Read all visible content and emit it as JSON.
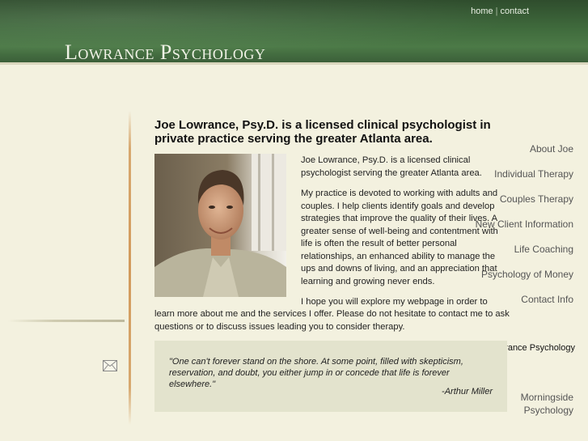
{
  "header": {
    "nav": {
      "home": "home",
      "separator": "|",
      "contact": "contact"
    },
    "logo_text": "Lowrance Psychology",
    "colors": {
      "header_green": "#3f6a3c",
      "background": "#f3f1df",
      "accent_rule": "#d29a5b"
    }
  },
  "sidebar": {
    "items": [
      {
        "label": "About Joe"
      },
      {
        "label": "Individual Therapy"
      },
      {
        "label": "Couples Therapy"
      },
      {
        "label": "New Client Information"
      },
      {
        "label": "Life Coaching"
      },
      {
        "label": "Psychology of Money"
      },
      {
        "label": "Contact Info"
      }
    ],
    "practice_label": "Lowrance Psychology",
    "mail_icon": "envelope-icon",
    "affiliate_line1": "Morningside",
    "affiliate_line2": "Psychology"
  },
  "main": {
    "headline": "Joe Lowrance, Psy.D. is a licensed clinical psychologist in private practice serving the greater Atlanta area.",
    "intro": "Joe Lowrance, Psy.D. is a licensed clinical psychologist serving the greater Atlanta area.",
    "practice_paragraph": "My practice is devoted to working with adults and couples. I help clients identify goals and develop strategies that improve the quality of their lives. A greater sense of well-being and contentment with life is often the result of better personal relationships, an enhanced ability to manage the ups and downs of living, and an appreciation that learning and growing never ends.",
    "explore_line1": "I hope you will explore my webpage in order to",
    "explore_rest": "learn more about me and the services I offer. Please do not hesitate to contact me to ask questions or to discuss issues leading you to consider therapy.",
    "quote": {
      "text": "\"One can't forever stand on the shore. At some point, filled with skepticism, reservation, and doubt, you either jump in or concede that life is forever elsewhere.\"",
      "author": "-Arthur Miller"
    }
  }
}
